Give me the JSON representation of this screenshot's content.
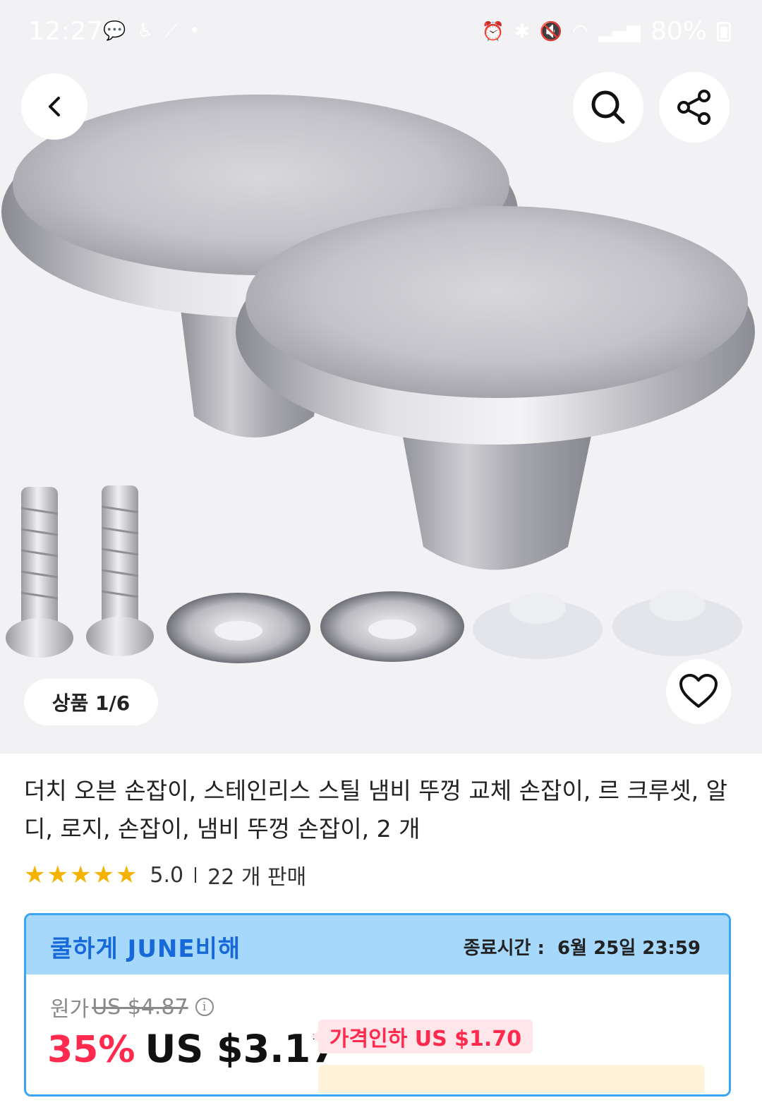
{
  "status_bar": {
    "time": "12:27",
    "battery": "80%",
    "left_icons": [
      "talk-icon",
      "accessibility-icon",
      "missed-call-icon",
      "dot-icon"
    ],
    "right_icons": [
      "alarm-icon",
      "bluetooth-icon",
      "mute-icon",
      "wifi-icon",
      "signal-icon",
      "battery-icon"
    ]
  },
  "gallery": {
    "counter": "상품 1/6"
  },
  "product": {
    "title": "더치 오븐 손잡이, 스테인리스 스틸 냄비 뚜껑 교체 손잡이, 르 크루셋, 알디, 로지, 손잡이, 냄비 뚜껑 손잡이, 2 개",
    "rating": "5.0",
    "sold": "22 개 판매",
    "star_count": 5
  },
  "deal": {
    "name": "쿨하게 JUNE비해",
    "end_label": "종료시간 :",
    "end_time": "6월 25일 23:59",
    "original_label": "원가",
    "original_price": "US $4.87",
    "discount": "35%",
    "price": "US $3.17",
    "price_drop": "가격인하 US $1.70"
  },
  "colors": {
    "accent_blue": "#1769d9",
    "deal_header_bg": "#a6d8fb",
    "deal_border": "#3aa5f2",
    "sale_red": "#ff2b4f",
    "star": "#f5b301"
  }
}
